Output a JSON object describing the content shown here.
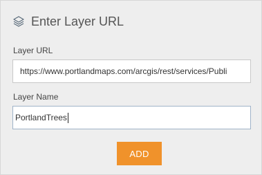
{
  "dialog": {
    "title": "Enter Layer URL",
    "icon": "layers-icon"
  },
  "form": {
    "url_label": "Layer URL",
    "url_value": "https://www.portlandmaps.com/arcgis/rest/services/Publi",
    "name_label": "Layer Name",
    "name_value": "PortlandTrees"
  },
  "actions": {
    "add_label": "ADD"
  },
  "colors": {
    "accent": "#f0922b",
    "panel_bg": "#eeeeee"
  }
}
